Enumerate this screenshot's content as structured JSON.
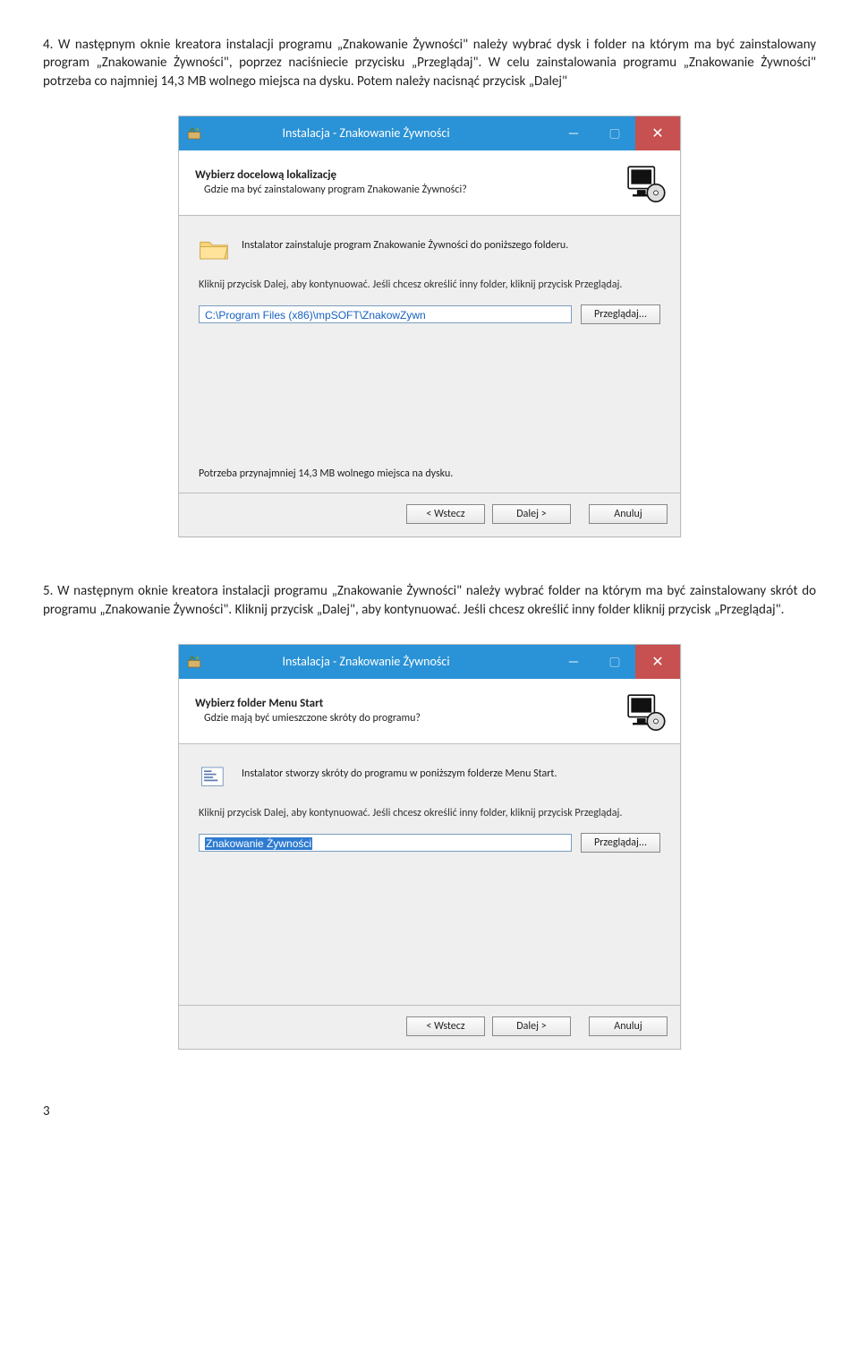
{
  "para1": "4. W następnym oknie kreatora instalacji programu „Znakowanie Żywności\" należy wybrać dysk i folder na którym ma być zainstalowany program „Znakowanie Żywności\", poprzez naciśniecie przycisku „Przeglądaj\". W celu zainstalowania  programu „Znakowanie Żywności\" potrzeba co najmniej 14,3 MB wolnego miejsca na dysku. Potem należy nacisnąć przycisk „Dalej\"",
  "para2": "5. W następnym oknie kreatora instalacji programu „Znakowanie Żywności\" należy wybrać folder na którym ma być zainstalowany skrót do programu „Znakowanie Żywności\". Kliknij przycisk „Dalej\", aby kontynuować. Jeśli chcesz określić inny folder kliknij przycisk „Przeglądaj\".",
  "dialog1": {
    "title": "Instalacja - Znakowanie Żywności",
    "header_h1": "Wybierz docelową lokalizację",
    "header_h2": "Gdzie ma być zainstalowany program Znakowanie Żywności?",
    "body_msg": "Instalator zainstaluje program Znakowanie Żywności do poniższego folderu.",
    "instr": "Kliknij przycisk Dalej, aby kontynuować. Jeśli chcesz określić inny folder, kliknij przycisk Przeglądaj.",
    "path": "C:\\Program Files (x86)\\mpSOFT\\ZnakowZywn",
    "browse": "Przeglądaj...",
    "space": "Potrzeba przynajmniej 14,3 MB wolnego miejsca na dysku.",
    "back": "< Wstecz",
    "next": "Dalej >",
    "cancel": "Anuluj"
  },
  "dialog2": {
    "title": "Instalacja - Znakowanie Żywności",
    "header_h1": "Wybierz folder Menu Start",
    "header_h2": "Gdzie mają być umieszczone skróty do programu?",
    "body_msg": "Instalator stworzy skróty do programu w poniższym folderze Menu Start.",
    "instr": "Kliknij przycisk Dalej, aby kontynuować. Jeśli chcesz określić inny folder, kliknij przycisk Przeglądaj.",
    "path": "Znakowanie Żywności",
    "browse": "Przeglądaj...",
    "back": "< Wstecz",
    "next": "Dalej >",
    "cancel": "Anuluj"
  },
  "page_number": "3"
}
